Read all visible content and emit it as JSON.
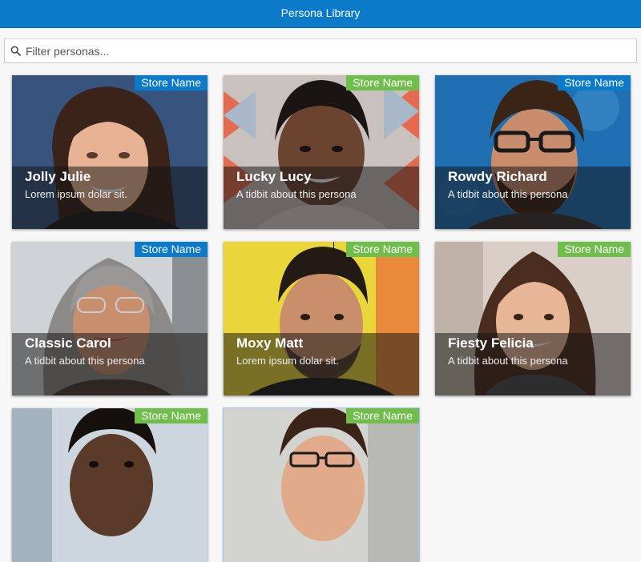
{
  "header": {
    "title": "Persona Library"
  },
  "search": {
    "placeholder": "Filter personas...",
    "icon": "search-icon"
  },
  "colors": {
    "header": "#0a7ac9",
    "badge_blue": "#0a7ac9",
    "badge_green": "#6fbd4a"
  },
  "personas": [
    {
      "name": "Jolly Julie",
      "tidbit": "Lorem ipsum dolar sit.",
      "store": "Store Name",
      "store_color": "blue"
    },
    {
      "name": "Lucky Lucy",
      "tidbit": "A tidbit about this persona",
      "store": "Store Name",
      "store_color": "green"
    },
    {
      "name": "Rowdy Richard",
      "tidbit": "A tidbit about this persona",
      "store": "Store Name",
      "store_color": "blue"
    },
    {
      "name": "Classic Carol",
      "tidbit": "A tidbit about this persona",
      "store": "Store Name",
      "store_color": "blue"
    },
    {
      "name": "Moxy Matt",
      "tidbit": "Lorem ipsum dolar sit.",
      "store": "Store Name",
      "store_color": "green"
    },
    {
      "name": "Fiesty Felicia",
      "tidbit": "A tidbit about this persona",
      "store": "Store Name",
      "store_color": "green"
    },
    {
      "name": "",
      "tidbit": "",
      "store": "Store Name",
      "store_color": "green"
    },
    {
      "name": "",
      "tidbit": "",
      "store": "Store Name",
      "store_color": "green"
    }
  ]
}
